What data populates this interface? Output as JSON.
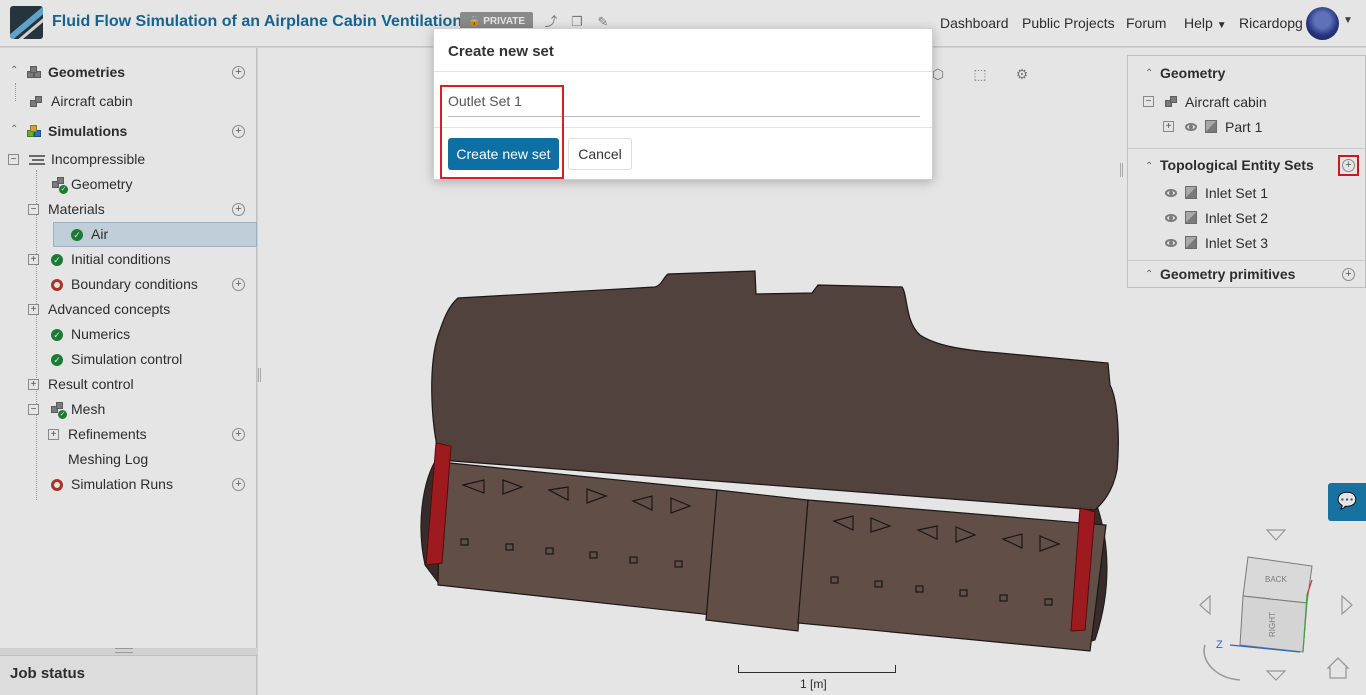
{
  "header": {
    "project_title": "Fluid Flow Simulation of an Airplane Cabin Ventilation",
    "privacy_badge": "PRIVATE",
    "nav": {
      "dashboard": "Dashboard",
      "public_projects": "Public Projects",
      "forum": "Forum",
      "help": "Help",
      "username": "Ricardopg"
    }
  },
  "left_tree": {
    "geometries_header": "Geometries",
    "geometry_item": "Aircraft cabin",
    "simulations_header": "Simulations",
    "simulation_name": "Incompressible",
    "items": {
      "geometry": "Geometry",
      "materials": "Materials",
      "air": "Air",
      "initial_conditions": "Initial conditions",
      "boundary_conditions": "Boundary conditions",
      "advanced_concepts": "Advanced concepts",
      "numerics": "Numerics",
      "simulation_control": "Simulation control",
      "result_control": "Result control",
      "mesh": "Mesh",
      "refinements": "Refinements",
      "meshing_log": "Meshing Log",
      "simulation_runs": "Simulation Runs"
    }
  },
  "job_status": {
    "title": "Job status"
  },
  "right_panel": {
    "geometry_header": "Geometry",
    "geometry_item": "Aircraft cabin",
    "part": "Part 1",
    "topological_header": "Topological Entity Sets",
    "sets": [
      "Inlet Set 1",
      "Inlet Set 2",
      "Inlet Set 3"
    ],
    "primitives_header": "Geometry primitives"
  },
  "viewer": {
    "scale_label": "1 [m]",
    "view_cube": {
      "back": "BACK",
      "right": "RIGHT",
      "z_axis": "Z"
    }
  },
  "dialog": {
    "title": "Create new set",
    "input_value": "Outlet Set 1",
    "create_button": "Create new set",
    "cancel_button": "Cancel"
  },
  "colors": {
    "brand_blue": "#1a6f9e",
    "primary_button": "#0e6fa5",
    "highlight_red": "#d81f26",
    "model_body": "#5c4a45",
    "status_ok": "#1e8a3c",
    "status_error": "#c0392b"
  }
}
